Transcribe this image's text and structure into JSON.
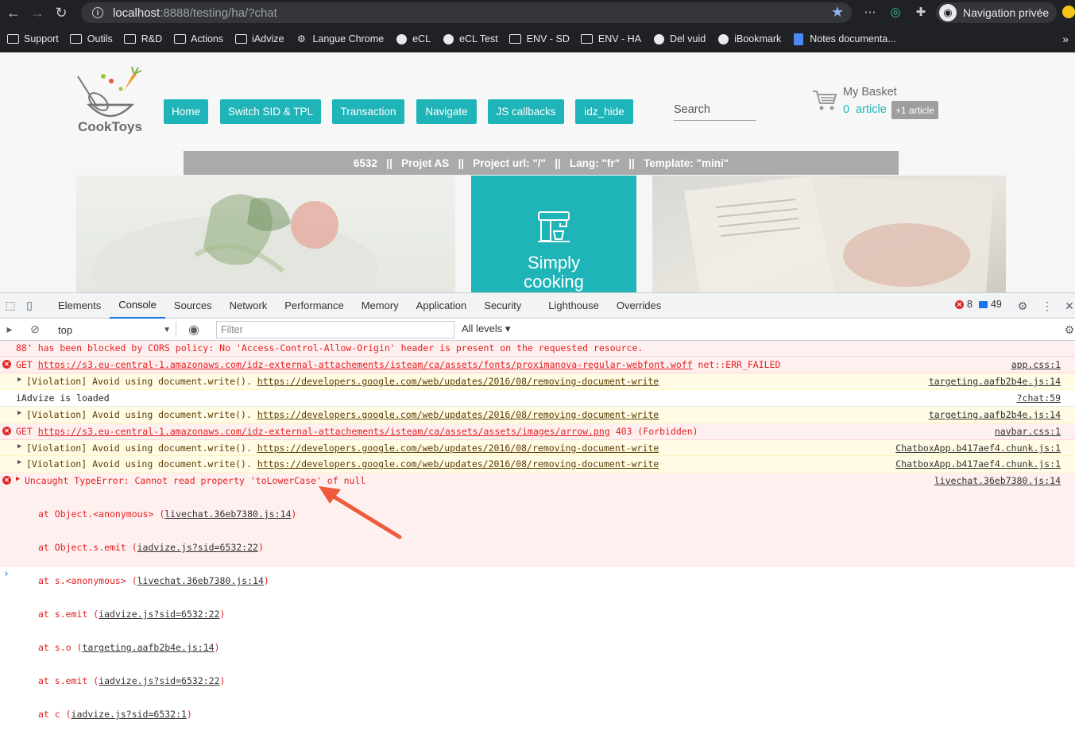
{
  "browser": {
    "url_host": "localhost",
    "url_rest": ":8888/testing/ha/?chat",
    "private_label": "Navigation privée"
  },
  "bookmarks": [
    {
      "label": "Support",
      "icon": "folder-icon"
    },
    {
      "label": "Outils",
      "icon": "folder-icon"
    },
    {
      "label": "R&D",
      "icon": "folder-icon"
    },
    {
      "label": "Actions",
      "icon": "folder-icon"
    },
    {
      "label": "iAdvize",
      "icon": "folder-icon"
    },
    {
      "label": "Langue Chrome",
      "icon": "gear-icon"
    },
    {
      "label": "eCL",
      "icon": "globe-icon"
    },
    {
      "label": "eCL Test",
      "icon": "globe-icon"
    },
    {
      "label": "ENV - SD",
      "icon": "folder-icon"
    },
    {
      "label": "ENV - HA",
      "icon": "folder-icon"
    },
    {
      "label": "Del vuid",
      "icon": "globe-icon"
    },
    {
      "label": "iBookmark",
      "icon": "globe-icon"
    },
    {
      "label": "Notes documenta...",
      "icon": "doc-icon"
    }
  ],
  "site": {
    "logo_text": "CookToys",
    "nav": [
      "Home",
      "Switch SID & TPL",
      "Transaction",
      "Navigate",
      "JS callbacks",
      "idz_hide"
    ],
    "search_placeholder": "Search",
    "basket_title": "My Basket",
    "basket_count": "0  article",
    "basket_badge": "+1 article",
    "infobar": "6532   ||   Projet AS   ||   Project url: \"/\"   ||   Lang: \"fr\"   ||   Template: \"mini\"",
    "hero_title_1": "Simply",
    "hero_title_2": "cooking"
  },
  "devtools": {
    "tabs": [
      "Elements",
      "Console",
      "Sources",
      "Network",
      "Performance",
      "Memory",
      "Application",
      "Security",
      "Lighthouse",
      "Overrides"
    ],
    "active_tab": "Console",
    "error_count": "8",
    "message_count": "49",
    "context": "top",
    "filter_placeholder": "Filter",
    "levels": "All levels"
  },
  "console": {
    "r0": "88' has been blocked by CORS policy: No 'Access-Control-Allow-Origin' header is present on the requested resource.",
    "r1_pre": "GET ",
    "r1_url": "https://s3.eu-central-1.amazonaws.com/idz-external-attachements/isteam/ca/assets/fonts/proximanova-regular-webfont.woff",
    "r1_post": " net::ERR_FAILED",
    "r1_src": "app.css:1",
    "r2_pre": "[Violation] Avoid using document.write(). ",
    "r2_url": "https://developers.google.com/web/updates/2016/08/removing-document-write",
    "r2_src": "targeting.aafb2b4e.js:14",
    "r3": "iAdvize is loaded",
    "r3_src": "?chat:59",
    "r4_pre": "[Violation] Avoid using document.write(). ",
    "r4_url": "https://developers.google.com/web/updates/2016/08/removing-document-write",
    "r4_src": "targeting.aafb2b4e.js:14",
    "r5_pre": "GET ",
    "r5_url": "https://s3.eu-central-1.amazonaws.com/idz-external-attachements/isteam/ca/assets/assets/images/arrow.png",
    "r5_post": " 403 (Forbidden)",
    "r5_src": "navbar.css:1",
    "r6_pre": "[Violation] Avoid using document.write(). ",
    "r6_url": "https://developers.google.com/web/updates/2016/08/removing-document-write",
    "r6_src": "ChatboxApp.b417aef4.chunk.js:1",
    "r7_pre": "[Violation] Avoid using document.write(). ",
    "r7_url": "https://developers.google.com/web/updates/2016/08/removing-document-write",
    "r7_src": "ChatboxApp.b417aef4.chunk.js:1",
    "r8": "Uncaught TypeError: Cannot read property 'toLowerCase' of null",
    "r8_src": "livechat.36eb7380.js:14",
    "stack": [
      {
        "pre": "at Object.<anonymous> (",
        "link": "livechat.36eb7380.js:14",
        "post": ")"
      },
      {
        "pre": "at Object.s.emit (",
        "link": "iadvize.js?sid=6532:22",
        "post": ")"
      },
      {
        "pre": "at s.<anonymous> (",
        "link": "livechat.36eb7380.js:14",
        "post": ")"
      },
      {
        "pre": "at s.emit (",
        "link": "iadvize.js?sid=6532:22",
        "post": ")"
      },
      {
        "pre": "at s.o (",
        "link": "targeting.aafb2b4e.js:14",
        "post": ")"
      },
      {
        "pre": "at s.emit (",
        "link": "iadvize.js?sid=6532:22",
        "post": ")"
      },
      {
        "pre": "at c (",
        "link": "iadvize.js?sid=6532:1",
        "post": ")"
      }
    ],
    "prompt": "›"
  },
  "colors": {
    "accent": "#1eb4b8",
    "error": "#e41f1f",
    "annotation_arrow": "#ee5a3a"
  }
}
